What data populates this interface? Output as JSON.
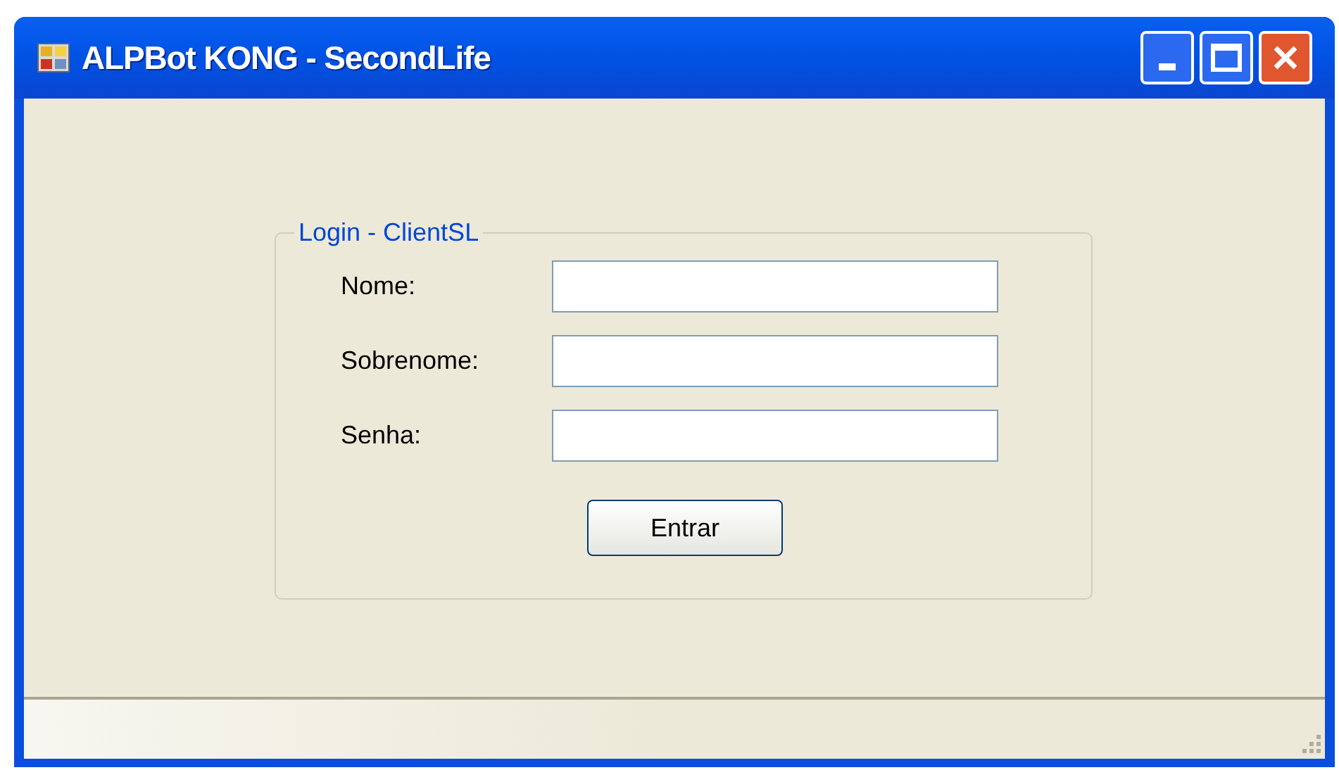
{
  "window": {
    "title": "ALPBot KONG - SecondLife"
  },
  "group": {
    "title": "Login - ClientSL",
    "fields": [
      {
        "label": "Nome:"
      },
      {
        "label": "Sobrenome:"
      },
      {
        "label": "Senha:"
      }
    ],
    "button": "Entrar"
  }
}
